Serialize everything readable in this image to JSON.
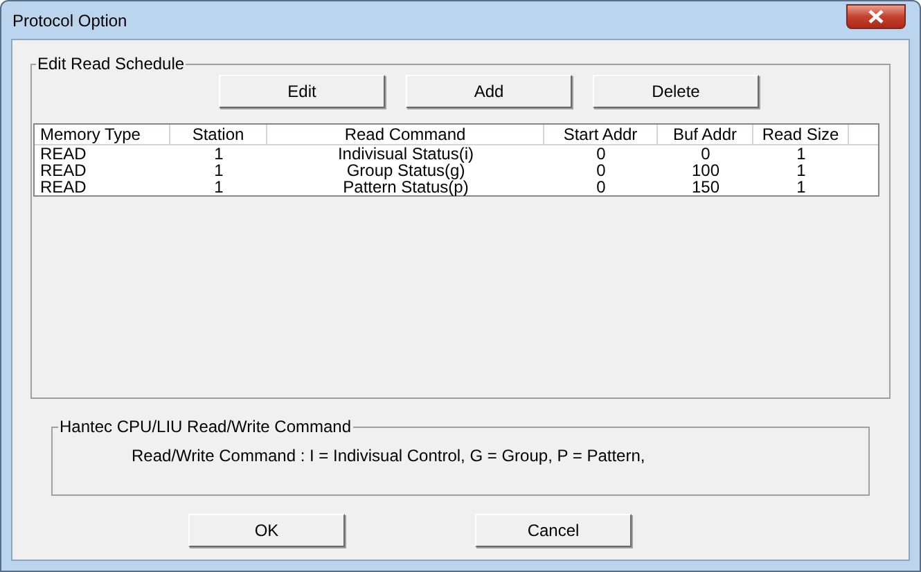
{
  "window": {
    "title": "Protocol Option"
  },
  "schedule": {
    "title": "Edit Read Schedule",
    "buttons": [
      "Edit",
      "Add",
      "Delete"
    ],
    "columns": [
      "Memory Type",
      "Station",
      "Read Command",
      "Start Addr",
      "Buf Addr",
      "Read Size"
    ],
    "rows": [
      [
        "READ",
        "1",
        "Indivisual Status(i)",
        "0",
        "0",
        "1"
      ],
      [
        "READ",
        "1",
        "Group Status(g)",
        "0",
        "100",
        "1"
      ],
      [
        "READ",
        "1",
        "Pattern Status(p)",
        "0",
        "150",
        "1"
      ]
    ]
  },
  "command_group": {
    "title": "Hantec CPU/LIU Read/Write Command",
    "text": "Read/Write Command : I = Indivisual Control, G = Group, P = Pattern,"
  },
  "buttons": [
    "OK",
    "Cancel"
  ]
}
